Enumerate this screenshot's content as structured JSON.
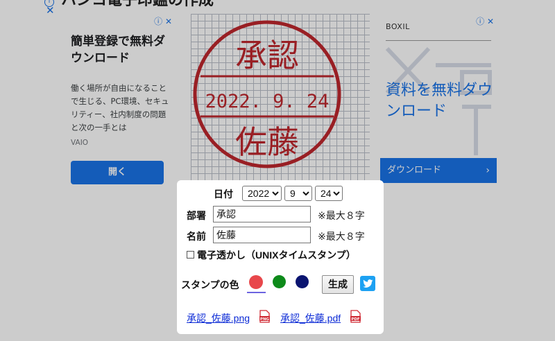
{
  "page": {
    "title": "ハンコ電子印鑑の作成"
  },
  "ad_left": {
    "headline": "簡単登録で無料ダウンロード",
    "body": "働く場所が自由になることで生じる、PC環境、セキュリティー、社内制度の問題と次の一手とは",
    "brand": "VAIO",
    "button": "開く",
    "info_icon": "info-icon",
    "close_icon": "close-icon"
  },
  "ad_right": {
    "brand": "BOXIL",
    "headline": "資料を無料ダウンロード",
    "button": "ダウンロード",
    "chevron": "›"
  },
  "stamp": {
    "top_text": "承認",
    "date_text": "2022. 9. 24",
    "bottom_text": "佐藤",
    "color": "#c0272d"
  },
  "form": {
    "date_label": "日付",
    "year": "2022",
    "month": "9",
    "day": "24",
    "dept_label": "部署",
    "dept_value": "承認",
    "dept_note": "※最大８字",
    "name_label": "名前",
    "name_value": "佐藤",
    "name_note": "※最大８字",
    "watermark_label": "電子透かし（UNIXタイムスタンプ）",
    "watermark_checked": false,
    "color_label": "スタンプの色",
    "colors": [
      "#e8474b",
      "#0d8a1a",
      "#0a1470"
    ],
    "selected_color": "#e8474b",
    "generate_button": "生成",
    "share_icon": "twitter-icon",
    "png_link": "承認_佐藤.png",
    "pdf_link": "承認_佐藤.pdf",
    "png_icon": "png-file-icon",
    "pdf_icon": "pdf-file-icon"
  }
}
